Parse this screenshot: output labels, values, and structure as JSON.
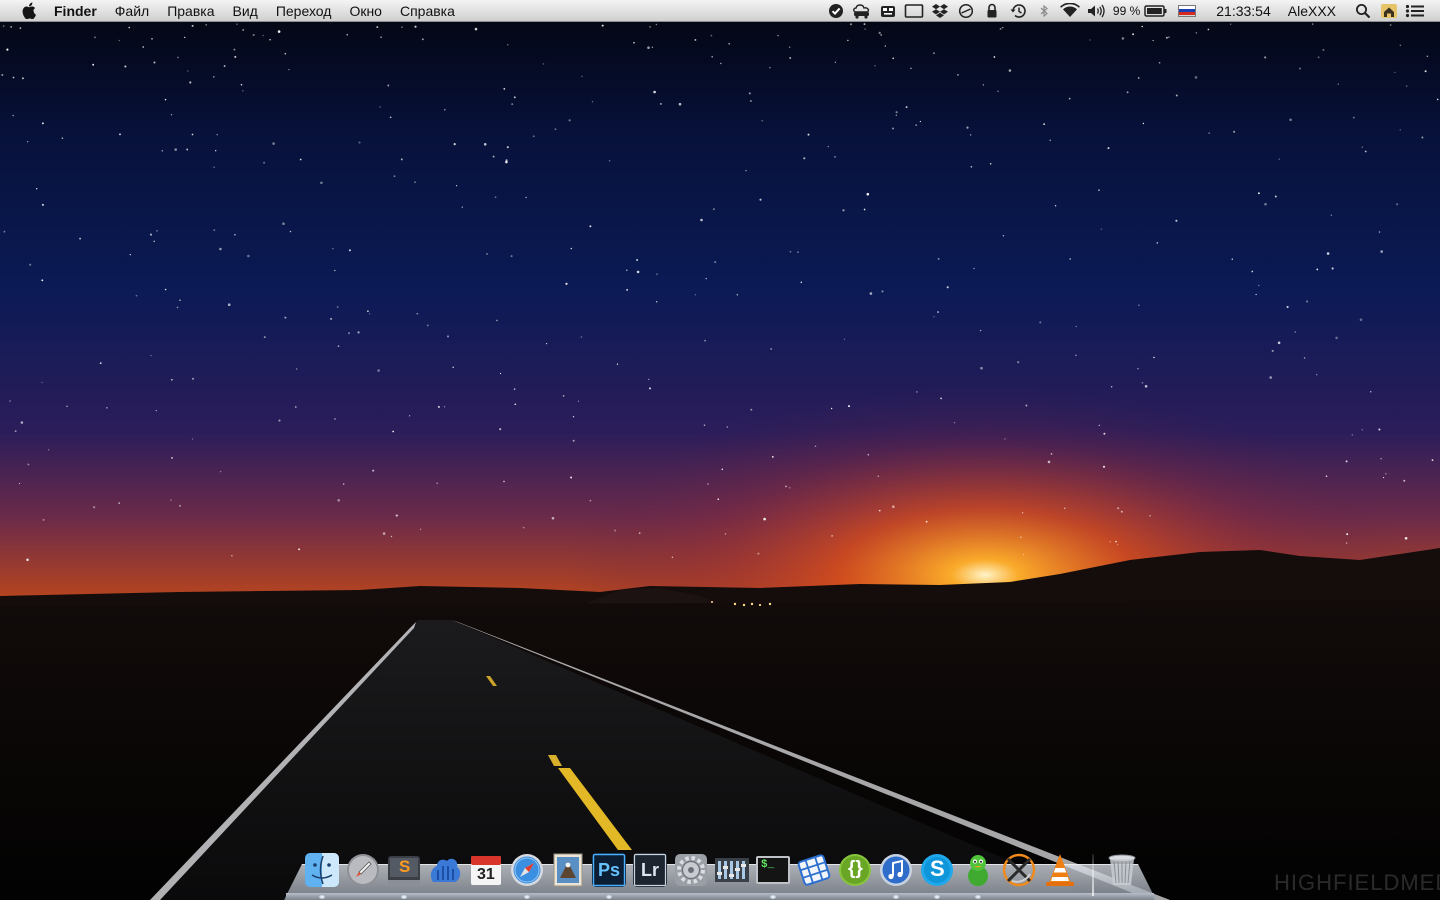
{
  "menubar": {
    "app_name": "Finder",
    "menus": [
      "Файл",
      "Правка",
      "Вид",
      "Переход",
      "Окно",
      "Справка"
    ],
    "status": {
      "battery_percent": "99 %",
      "battery_level": 0.99,
      "input_source": "ru",
      "clock": "21:33:54",
      "user": "AleXXX"
    },
    "tray_icons": [
      "checkmark-shield-icon",
      "cloud-car-icon",
      "robot-face-icon",
      "display-icon",
      "dropbox-icon",
      "sync-circle-icon",
      "lock-icon",
      "time-machine-icon",
      "bluetooth-icon",
      "wifi-icon",
      "volume-icon",
      "battery-icon",
      "russian-flag-icon",
      "spotlight-icon",
      "home-icon",
      "notification-list-icon"
    ]
  },
  "flag_colors": [
    "#ffffff",
    "#1c3fb8",
    "#d52b1e"
  ],
  "dock": {
    "apps": [
      {
        "name": "finder",
        "icon": "finder-icon"
      },
      {
        "name": "launchpad",
        "icon": "rocket-icon"
      },
      {
        "name": "sublime-text",
        "icon": "sublime-icon",
        "glyph": "S"
      },
      {
        "name": "cyberduck",
        "icon": "hand-cloud-icon"
      },
      {
        "name": "calendar",
        "icon": "calendar-icon",
        "glyph": "31"
      },
      {
        "name": "safari",
        "icon": "compass-icon"
      },
      {
        "name": "preview",
        "icon": "eagle-stamp-icon"
      },
      {
        "name": "photoshop",
        "icon": "photoshop-icon",
        "glyph": "Ps"
      },
      {
        "name": "lightroom",
        "icon": "lightroom-icon",
        "glyph": "Lr"
      },
      {
        "name": "system-preferences",
        "icon": "gear-icon"
      },
      {
        "name": "mixer",
        "icon": "equalizer-icon"
      },
      {
        "name": "terminal",
        "icon": "terminal-icon",
        "glyph": "$_"
      },
      {
        "name": "webmoney",
        "icon": "wallet-grid-icon"
      },
      {
        "name": "brackets",
        "icon": "braces-icon",
        "glyph": "{}"
      },
      {
        "name": "itunes",
        "icon": "music-note-icon"
      },
      {
        "name": "skype",
        "icon": "skype-icon",
        "glyph": "S"
      },
      {
        "name": "adium",
        "icon": "green-duck-icon"
      },
      {
        "name": "crossover",
        "icon": "x-circle-icon"
      },
      {
        "name": "vlc",
        "icon": "traffic-cone-icon"
      }
    ],
    "trash": {
      "name": "trash",
      "icon": "trash-icon"
    }
  },
  "watermark": "HIGHFIELDMEDIA"
}
